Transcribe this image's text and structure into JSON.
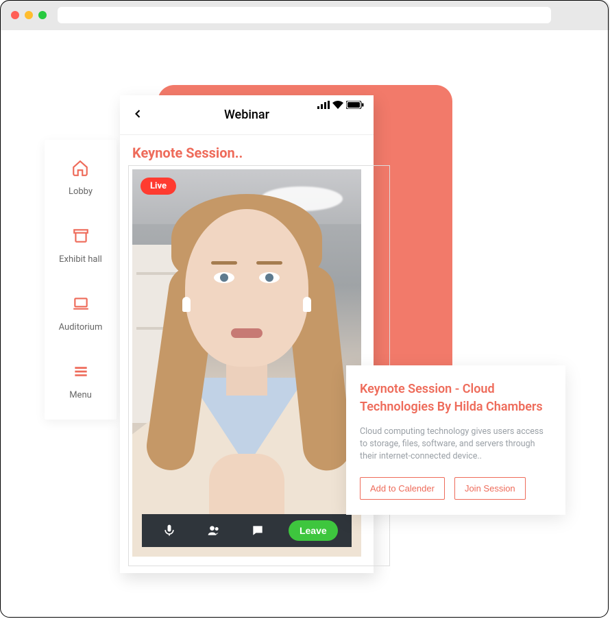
{
  "colors": {
    "accent": "#ee6b5a",
    "live": "#ff3b30",
    "leave": "#3ec63e"
  },
  "sidebar": {
    "items": [
      {
        "label": "Lobby",
        "icon": "home-icon"
      },
      {
        "label": "Exhibit hall",
        "icon": "booth-icon"
      },
      {
        "label": "Auditorium",
        "icon": "laptop-icon"
      },
      {
        "label": "Menu",
        "icon": "menu-icon"
      }
    ]
  },
  "phone": {
    "title": "Webinar",
    "session_heading": "Keynote Session..",
    "live_label": "Live",
    "controls": {
      "leave_label": "Leave"
    }
  },
  "detail": {
    "title": "Keynote Session - Cloud Technologies  By Hilda Chambers",
    "description": "Cloud computing technology gives users access to storage, files, software, and servers through their internet-connected device..",
    "add_calendar_label": "Add to Calender",
    "join_label": "Join Session"
  }
}
